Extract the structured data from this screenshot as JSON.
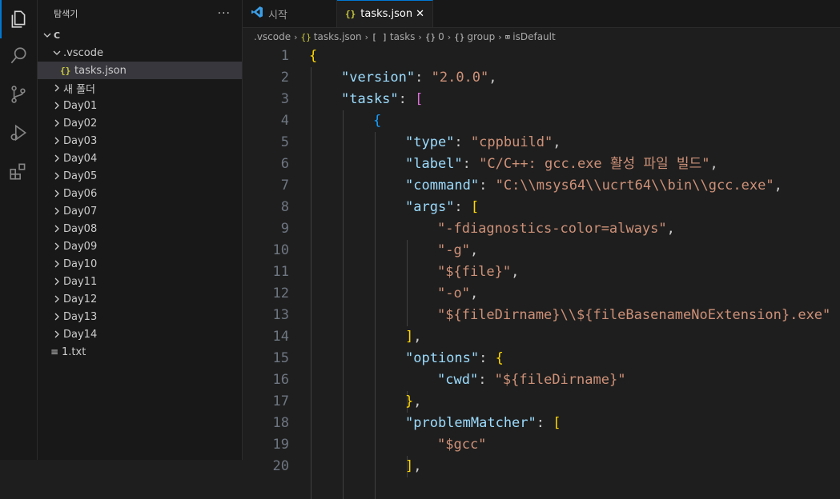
{
  "activity_bar": [
    "explorer-icon",
    "search-icon",
    "source-control-icon",
    "run-debug-icon",
    "extensions-icon"
  ],
  "sidebar": {
    "title": "탐색기",
    "more": "···",
    "root": "C",
    "items": [
      {
        "label": ".vscode",
        "kind": "folder-open",
        "depth": 1
      },
      {
        "label": "tasks.json",
        "kind": "json",
        "depth": 2,
        "selected": true
      },
      {
        "label": "새 폴더",
        "kind": "folder",
        "depth": 1
      },
      {
        "label": "Day01",
        "kind": "folder",
        "depth": 1
      },
      {
        "label": "Day02",
        "kind": "folder",
        "depth": 1
      },
      {
        "label": "Day03",
        "kind": "folder",
        "depth": 1
      },
      {
        "label": "Day04",
        "kind": "folder",
        "depth": 1
      },
      {
        "label": "Day05",
        "kind": "folder",
        "depth": 1
      },
      {
        "label": "Day06",
        "kind": "folder",
        "depth": 1
      },
      {
        "label": "Day07",
        "kind": "folder",
        "depth": 1
      },
      {
        "label": "Day08",
        "kind": "folder",
        "depth": 1
      },
      {
        "label": "Day09",
        "kind": "folder",
        "depth": 1
      },
      {
        "label": "Day10",
        "kind": "folder",
        "depth": 1
      },
      {
        "label": "Day11",
        "kind": "folder",
        "depth": 1
      },
      {
        "label": "Day12",
        "kind": "folder",
        "depth": 1
      },
      {
        "label": "Day13",
        "kind": "folder",
        "depth": 1
      },
      {
        "label": "Day14",
        "kind": "folder",
        "depth": 1
      },
      {
        "label": "1.txt",
        "kind": "txt",
        "depth": 1
      }
    ]
  },
  "tabs": [
    {
      "label": "시작",
      "active": false,
      "icon": "vscode-icon"
    },
    {
      "label": "tasks.json",
      "active": true,
      "icon": "json-icon",
      "close": "✕"
    }
  ],
  "breadcrumb": [
    {
      "icon": "",
      "label": ".vscode"
    },
    {
      "icon": "{}",
      "label": "tasks.json"
    },
    {
      "icon": "[ ]",
      "label": "tasks"
    },
    {
      "icon": "{}",
      "label": "0"
    },
    {
      "icon": "{}",
      "label": "group"
    },
    {
      "icon": "⌧",
      "label": "isDefault"
    }
  ],
  "code_lines": [
    {
      "n": "1",
      "indent": 0,
      "tokens": [
        [
          "b1",
          "{"
        ]
      ]
    },
    {
      "n": "2",
      "indent": 1,
      "tokens": [
        [
          "k",
          "\"version\""
        ],
        [
          "p",
          ": "
        ],
        [
          "s",
          "\"2.0.0\""
        ],
        [
          "p",
          ","
        ]
      ]
    },
    {
      "n": "3",
      "indent": 1,
      "tokens": [
        [
          "k",
          "\"tasks\""
        ],
        [
          "p",
          ": "
        ],
        [
          "b2",
          "["
        ]
      ]
    },
    {
      "n": "4",
      "indent": 2,
      "tokens": [
        [
          "b3",
          "{"
        ]
      ]
    },
    {
      "n": "5",
      "indent": 3,
      "tokens": [
        [
          "k",
          "\"type\""
        ],
        [
          "p",
          ": "
        ],
        [
          "s",
          "\"cppbuild\""
        ],
        [
          "p",
          ","
        ]
      ]
    },
    {
      "n": "6",
      "indent": 3,
      "tokens": [
        [
          "k",
          "\"label\""
        ],
        [
          "p",
          ": "
        ],
        [
          "s",
          "\"C/C++: gcc.exe 활성 파일 빌드\""
        ],
        [
          "p",
          ","
        ]
      ]
    },
    {
      "n": "7",
      "indent": 3,
      "tokens": [
        [
          "k",
          "\"command\""
        ],
        [
          "p",
          ": "
        ],
        [
          "s",
          "\"C:\\\\msys64\\\\ucrt64\\\\bin\\\\gcc.exe\""
        ],
        [
          "p",
          ","
        ]
      ]
    },
    {
      "n": "8",
      "indent": 3,
      "tokens": [
        [
          "k",
          "\"args\""
        ],
        [
          "p",
          ": "
        ],
        [
          "b1",
          "["
        ]
      ]
    },
    {
      "n": "9",
      "indent": 4,
      "tokens": [
        [
          "s",
          "\"-fdiagnostics-color=always\""
        ],
        [
          "p",
          ","
        ]
      ]
    },
    {
      "n": "10",
      "indent": 4,
      "tokens": [
        [
          "s",
          "\"-g\""
        ],
        [
          "p",
          ","
        ]
      ]
    },
    {
      "n": "11",
      "indent": 4,
      "tokens": [
        [
          "s",
          "\"${file}\""
        ],
        [
          "p",
          ","
        ]
      ]
    },
    {
      "n": "12",
      "indent": 4,
      "tokens": [
        [
          "s",
          "\"-o\""
        ],
        [
          "p",
          ","
        ]
      ]
    },
    {
      "n": "13",
      "indent": 4,
      "tokens": [
        [
          "s",
          "\"${fileDirname}\\\\${fileBasenameNoExtension}.exe\""
        ]
      ]
    },
    {
      "n": "14",
      "indent": 3,
      "tokens": [
        [
          "b1",
          "]"
        ],
        [
          "p",
          ","
        ]
      ]
    },
    {
      "n": "15",
      "indent": 3,
      "tokens": [
        [
          "k",
          "\"options\""
        ],
        [
          "p",
          ": "
        ],
        [
          "b1",
          "{"
        ]
      ]
    },
    {
      "n": "16",
      "indent": 4,
      "tokens": [
        [
          "k",
          "\"cwd\""
        ],
        [
          "p",
          ": "
        ],
        [
          "s",
          "\"${fileDirname}\""
        ]
      ]
    },
    {
      "n": "17",
      "indent": 3,
      "tokens": [
        [
          "b1",
          "}"
        ],
        [
          "p",
          ","
        ]
      ]
    },
    {
      "n": "18",
      "indent": 3,
      "tokens": [
        [
          "k",
          "\"problemMatcher\""
        ],
        [
          "p",
          ": "
        ],
        [
          "b1",
          "["
        ]
      ]
    },
    {
      "n": "19",
      "indent": 4,
      "tokens": [
        [
          "s",
          "\"$gcc\""
        ]
      ]
    },
    {
      "n": "20",
      "indent": 3,
      "tokens": [
        [
          "b1",
          "]"
        ],
        [
          "p",
          ","
        ]
      ]
    }
  ],
  "colors": {
    "accent": "#0078d4",
    "key": "#9cdcfe",
    "string": "#ce9178",
    "bracket_gold": "#ffd700",
    "bracket_purple": "#da70d6",
    "bracket_blue": "#179fff"
  }
}
